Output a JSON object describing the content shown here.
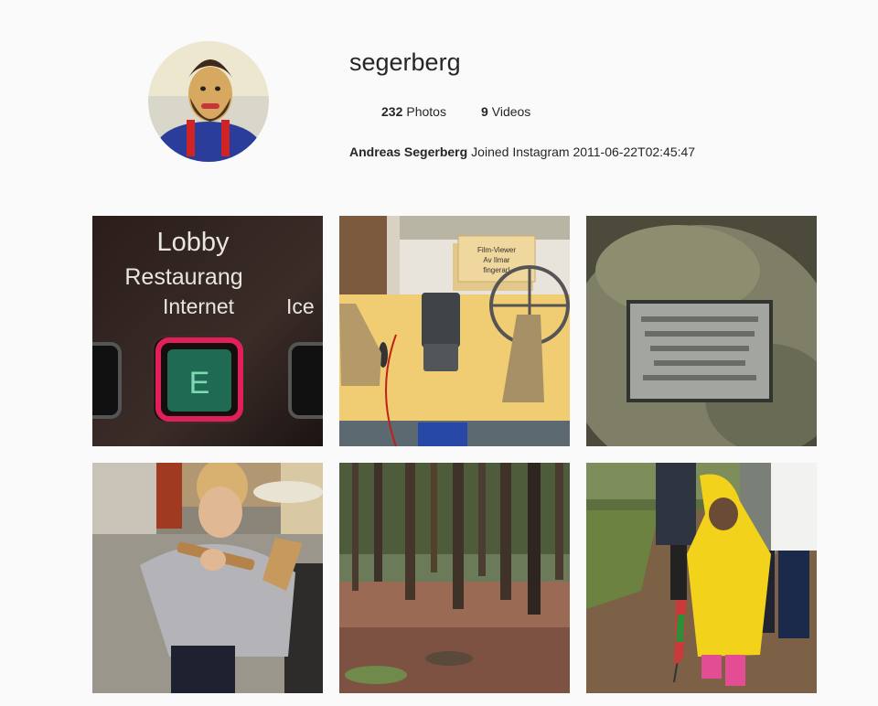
{
  "profile": {
    "username": "segerberg",
    "full_name": "Andreas Segerberg",
    "joined_text": "Joined Instagram 2011-06-22T02:45:47",
    "avatar_icon": "knitted-bearded-figure"
  },
  "stats": {
    "photos_count": "232",
    "photos_label": "Photos",
    "videos_count": "9",
    "videos_label": "Videos"
  },
  "photos": [
    {
      "subject": "elevator-panel",
      "sign_lines": [
        "Lobby",
        "Restaurang",
        "Internet"
      ],
      "sign_partial": "Ice",
      "button_letter": "E"
    },
    {
      "subject": "film-viewer-museum",
      "note_text": "Film-Viewer\nAv Ilmar\nfingerar!"
    },
    {
      "subject": "stone-plaque"
    },
    {
      "subject": "boy-with-wooden-toy"
    },
    {
      "subject": "forest"
    },
    {
      "subject": "child-in-yellow-raincoat"
    }
  ],
  "colors": {
    "background": "#fafafa",
    "text": "#262626",
    "elevator_glow": "#e0205a",
    "raincoat": "#f2d21a",
    "table": "#efc96a"
  }
}
